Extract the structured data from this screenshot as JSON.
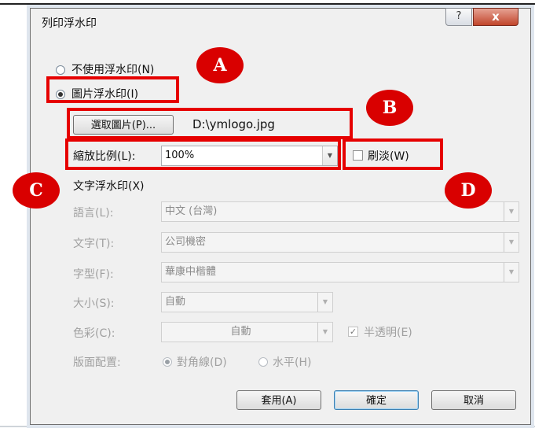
{
  "dialog": {
    "title": "列印浮水印",
    "help_label": "?",
    "close_label": "x"
  },
  "options": {
    "no_watermark_label": "不使用浮水印(N)",
    "picture_watermark_label": "圖片浮水印(I)",
    "select_picture_button": "選取圖片(P)...",
    "picture_path": "D:\\ymlogo.jpg",
    "scale_label": "縮放比例(L):",
    "scale_value": "100%",
    "washout_label": "刷淡(W)",
    "text_watermark_label": "文字浮水印(X)"
  },
  "text_options": {
    "language_label": "語言(L):",
    "language_value": "中文 (台灣)",
    "text_label": "文字(T):",
    "text_value": "公司機密",
    "font_label": "字型(F):",
    "font_value": "華康中楷體",
    "size_label": "大小(S):",
    "size_value": "自動",
    "color_label": "色彩(C):",
    "color_value": "自動",
    "semitransparent_label": "半透明(E)",
    "layout_label": "版面配置:",
    "diagonal_label": "對角線(D)",
    "horizontal_label": "水平(H)"
  },
  "buttons": {
    "apply": "套用(A)",
    "ok": "確定",
    "cancel": "取消"
  },
  "annotations": {
    "A": "A",
    "B": "B",
    "C": "C",
    "D": "D"
  },
  "colors": {
    "annotation_red": "#e60000",
    "marker_red": "#d90000"
  }
}
